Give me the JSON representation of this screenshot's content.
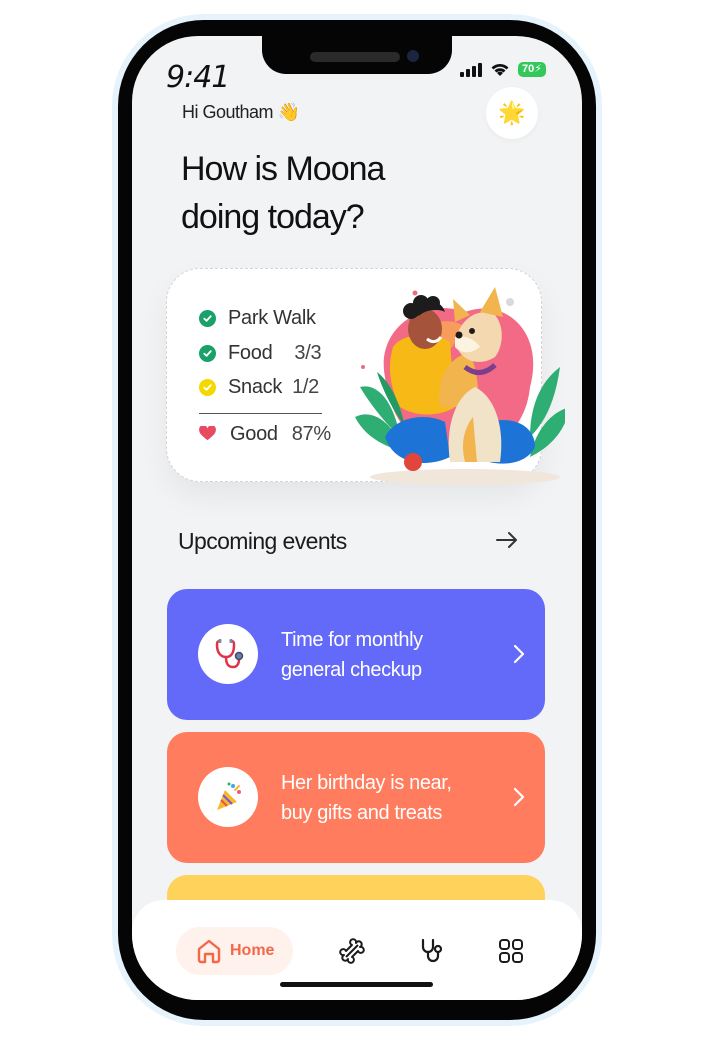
{
  "status_bar": {
    "time": "9:41",
    "battery": "70"
  },
  "header": {
    "greeting": "Hi Goutham",
    "greeting_emoji": "👋",
    "avatar_emoji": "🌟",
    "title_line1": "How is Moona",
    "title_line2": "doing today?"
  },
  "stats": [
    {
      "label": "Park Walk",
      "value": "",
      "status": "done"
    },
    {
      "label": "Food",
      "value": "3/3",
      "status": "done"
    },
    {
      "label": "Snack",
      "value": "1/2",
      "status": "partial"
    }
  ],
  "mood": {
    "label": "Good",
    "value": "87%"
  },
  "upcoming": {
    "title": "Upcoming events"
  },
  "events": [
    {
      "text_line1": "Time for monthly",
      "text_line2": "general checkup",
      "icon": "stethoscope-icon",
      "color": "#636af9"
    },
    {
      "text_line1": "Her birthday is near,",
      "text_line2": "buy gifts and treats",
      "icon": "party-popper-icon",
      "color": "#ff7d5e"
    }
  ],
  "tabbar": {
    "home_label": "Home",
    "accent": "#f26848"
  },
  "colors": {
    "done": "#1aa06b",
    "partial": "#f5d800",
    "heart": "#e84a5f",
    "upcoming_card_3": "#ffd25c"
  }
}
